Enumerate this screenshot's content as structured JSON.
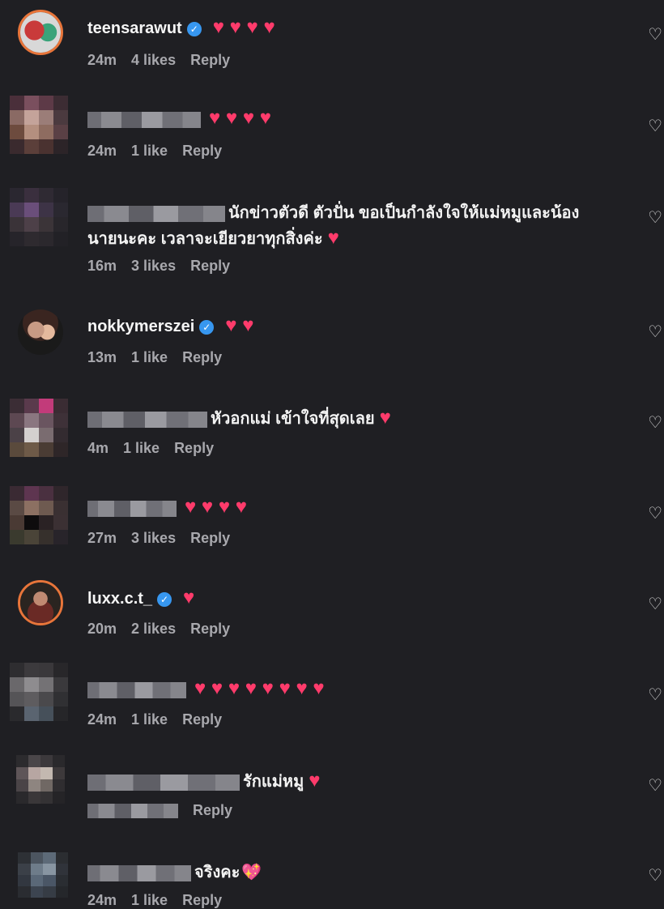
{
  "comments": [
    {
      "username": "teensarawut",
      "verified": true,
      "text": "",
      "hearts": "♥ ♥ ♥ ♥",
      "time": "24m",
      "likes": "4 likes",
      "reply": "Reply"
    },
    {
      "username": "",
      "verified": false,
      "text": "",
      "hearts": "♥ ♥ ♥ ♥",
      "time": "24m",
      "likes": "1 like",
      "reply": "Reply"
    },
    {
      "username": "",
      "verified": false,
      "text": "นักข่าวตัวดี ตัวปั่น ขอเป็นกำลังใจให้แม่หมูและน้อง",
      "text2": "นายนะคะ เวลาจะเยียวยาทุกสิ่งค่ะ",
      "hearts": "♥",
      "time": "16m",
      "likes": "3 likes",
      "reply": "Reply"
    },
    {
      "username": "nokkymerszei",
      "verified": true,
      "text": "",
      "hearts": "♥ ♥",
      "time": "13m",
      "likes": "1 like",
      "reply": "Reply"
    },
    {
      "username": "",
      "verified": false,
      "text": "หัวอกแม่ เข้าใจที่สุดเลย",
      "hearts": "♥",
      "time": "4m",
      "likes": "1 like",
      "reply": "Reply"
    },
    {
      "username": "",
      "verified": false,
      "text": "",
      "hearts": "♥ ♥ ♥ ♥",
      "time": "27m",
      "likes": "3 likes",
      "reply": "Reply"
    },
    {
      "username": "luxx.c.t_",
      "verified": true,
      "text": "",
      "hearts": "♥",
      "time": "20m",
      "likes": "2 likes",
      "reply": "Reply"
    },
    {
      "username": "",
      "verified": false,
      "text": "",
      "hearts": "♥ ♥ ♥ ♥ ♥ ♥ ♥ ♥",
      "time": "24m",
      "likes": "1 like",
      "reply": "Reply"
    },
    {
      "username": "",
      "verified": false,
      "text": "รักแม่หมู",
      "hearts": "♥",
      "time": "",
      "likes": "",
      "reply": "Reply"
    },
    {
      "username": "",
      "verified": false,
      "text": "จริงคะ",
      "hearts": "💖",
      "time": "24m",
      "likes": "1 like",
      "reply": "Reply"
    }
  ],
  "icons": {
    "like": "heart-outline-icon",
    "verified": "verified-badge-icon"
  },
  "colors": {
    "background": "#1f1f23",
    "heart": "#ff3b6b",
    "verified": "#3797f0",
    "meta": "#a8a8ad"
  }
}
